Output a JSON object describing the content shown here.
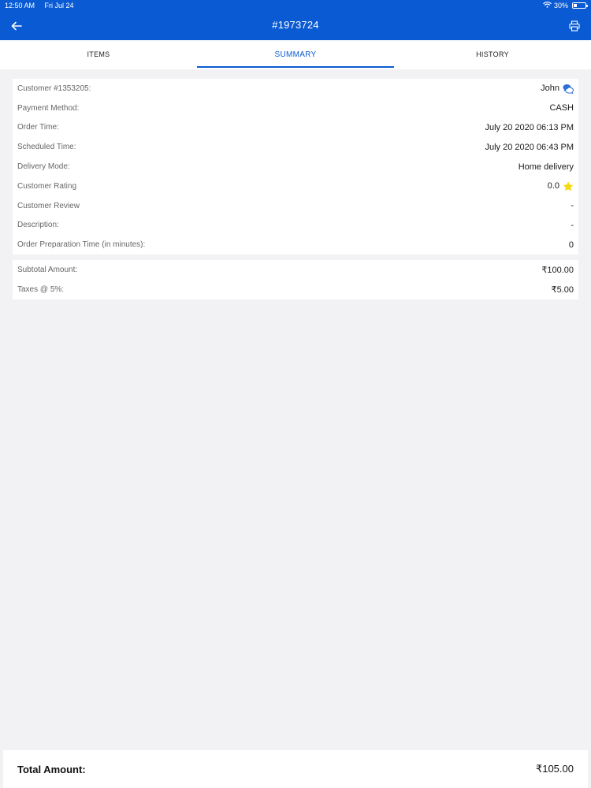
{
  "status": {
    "time": "12:50 AM",
    "date": "Fri Jul 24",
    "battery": "30%",
    "battery_level": 0.3
  },
  "header": {
    "title": "#1973724",
    "back_icon": "arrow-left-icon",
    "print_icon": "printer-icon",
    "color": "#0a5bd3"
  },
  "tabs": [
    {
      "label": "ITEMS",
      "active": false
    },
    {
      "label": "SUMMARY",
      "active": true
    },
    {
      "label": "HISTORY",
      "active": false
    }
  ],
  "details": [
    {
      "label": "Customer #1353205:",
      "value": "John",
      "icon": "chat-icon"
    },
    {
      "label": "Payment Method:",
      "value": "CASH"
    },
    {
      "label": "Order Time:",
      "value": "July 20 2020 06:13 PM"
    },
    {
      "label": "Scheduled Time:",
      "value": "July 20 2020 06:43 PM"
    },
    {
      "label": "Delivery Mode:",
      "value": "Home delivery"
    },
    {
      "label": "Customer Rating",
      "value": "0.0",
      "icon": "star-icon"
    },
    {
      "label": "Customer Review",
      "value": "-"
    },
    {
      "label": "Description:",
      "value": "-"
    },
    {
      "label": "Order Preparation Time (in minutes):",
      "value": "0"
    }
  ],
  "amounts": [
    {
      "label": "Subtotal Amount:",
      "value": "₹100.00"
    },
    {
      "label": "Taxes @ 5%:",
      "value": "₹5.00"
    }
  ],
  "footer": {
    "total_label": "Total Amount:",
    "total_value": "₹105.00"
  },
  "colors": {
    "accent": "#0a5bd3",
    "star": "#f5d90a",
    "background": "#f2f2f4"
  }
}
